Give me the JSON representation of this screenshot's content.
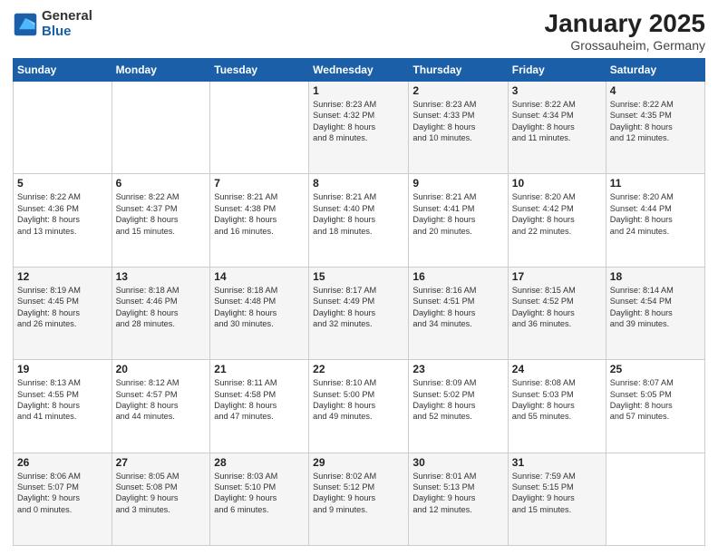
{
  "header": {
    "logo_general": "General",
    "logo_blue": "Blue",
    "title": "January 2025",
    "location": "Grossauheim, Germany"
  },
  "weekdays": [
    "Sunday",
    "Monday",
    "Tuesday",
    "Wednesday",
    "Thursday",
    "Friday",
    "Saturday"
  ],
  "weeks": [
    [
      {
        "day": "",
        "info": ""
      },
      {
        "day": "",
        "info": ""
      },
      {
        "day": "",
        "info": ""
      },
      {
        "day": "1",
        "info": "Sunrise: 8:23 AM\nSunset: 4:32 PM\nDaylight: 8 hours\nand 8 minutes."
      },
      {
        "day": "2",
        "info": "Sunrise: 8:23 AM\nSunset: 4:33 PM\nDaylight: 8 hours\nand 10 minutes."
      },
      {
        "day": "3",
        "info": "Sunrise: 8:22 AM\nSunset: 4:34 PM\nDaylight: 8 hours\nand 11 minutes."
      },
      {
        "day": "4",
        "info": "Sunrise: 8:22 AM\nSunset: 4:35 PM\nDaylight: 8 hours\nand 12 minutes."
      }
    ],
    [
      {
        "day": "5",
        "info": "Sunrise: 8:22 AM\nSunset: 4:36 PM\nDaylight: 8 hours\nand 13 minutes."
      },
      {
        "day": "6",
        "info": "Sunrise: 8:22 AM\nSunset: 4:37 PM\nDaylight: 8 hours\nand 15 minutes."
      },
      {
        "day": "7",
        "info": "Sunrise: 8:21 AM\nSunset: 4:38 PM\nDaylight: 8 hours\nand 16 minutes."
      },
      {
        "day": "8",
        "info": "Sunrise: 8:21 AM\nSunset: 4:40 PM\nDaylight: 8 hours\nand 18 minutes."
      },
      {
        "day": "9",
        "info": "Sunrise: 8:21 AM\nSunset: 4:41 PM\nDaylight: 8 hours\nand 20 minutes."
      },
      {
        "day": "10",
        "info": "Sunrise: 8:20 AM\nSunset: 4:42 PM\nDaylight: 8 hours\nand 22 minutes."
      },
      {
        "day": "11",
        "info": "Sunrise: 8:20 AM\nSunset: 4:44 PM\nDaylight: 8 hours\nand 24 minutes."
      }
    ],
    [
      {
        "day": "12",
        "info": "Sunrise: 8:19 AM\nSunset: 4:45 PM\nDaylight: 8 hours\nand 26 minutes."
      },
      {
        "day": "13",
        "info": "Sunrise: 8:18 AM\nSunset: 4:46 PM\nDaylight: 8 hours\nand 28 minutes."
      },
      {
        "day": "14",
        "info": "Sunrise: 8:18 AM\nSunset: 4:48 PM\nDaylight: 8 hours\nand 30 minutes."
      },
      {
        "day": "15",
        "info": "Sunrise: 8:17 AM\nSunset: 4:49 PM\nDaylight: 8 hours\nand 32 minutes."
      },
      {
        "day": "16",
        "info": "Sunrise: 8:16 AM\nSunset: 4:51 PM\nDaylight: 8 hours\nand 34 minutes."
      },
      {
        "day": "17",
        "info": "Sunrise: 8:15 AM\nSunset: 4:52 PM\nDaylight: 8 hours\nand 36 minutes."
      },
      {
        "day": "18",
        "info": "Sunrise: 8:14 AM\nSunset: 4:54 PM\nDaylight: 8 hours\nand 39 minutes."
      }
    ],
    [
      {
        "day": "19",
        "info": "Sunrise: 8:13 AM\nSunset: 4:55 PM\nDaylight: 8 hours\nand 41 minutes."
      },
      {
        "day": "20",
        "info": "Sunrise: 8:12 AM\nSunset: 4:57 PM\nDaylight: 8 hours\nand 44 minutes."
      },
      {
        "day": "21",
        "info": "Sunrise: 8:11 AM\nSunset: 4:58 PM\nDaylight: 8 hours\nand 47 minutes."
      },
      {
        "day": "22",
        "info": "Sunrise: 8:10 AM\nSunset: 5:00 PM\nDaylight: 8 hours\nand 49 minutes."
      },
      {
        "day": "23",
        "info": "Sunrise: 8:09 AM\nSunset: 5:02 PM\nDaylight: 8 hours\nand 52 minutes."
      },
      {
        "day": "24",
        "info": "Sunrise: 8:08 AM\nSunset: 5:03 PM\nDaylight: 8 hours\nand 55 minutes."
      },
      {
        "day": "25",
        "info": "Sunrise: 8:07 AM\nSunset: 5:05 PM\nDaylight: 8 hours\nand 57 minutes."
      }
    ],
    [
      {
        "day": "26",
        "info": "Sunrise: 8:06 AM\nSunset: 5:07 PM\nDaylight: 9 hours\nand 0 minutes."
      },
      {
        "day": "27",
        "info": "Sunrise: 8:05 AM\nSunset: 5:08 PM\nDaylight: 9 hours\nand 3 minutes."
      },
      {
        "day": "28",
        "info": "Sunrise: 8:03 AM\nSunset: 5:10 PM\nDaylight: 9 hours\nand 6 minutes."
      },
      {
        "day": "29",
        "info": "Sunrise: 8:02 AM\nSunset: 5:12 PM\nDaylight: 9 hours\nand 9 minutes."
      },
      {
        "day": "30",
        "info": "Sunrise: 8:01 AM\nSunset: 5:13 PM\nDaylight: 9 hours\nand 12 minutes."
      },
      {
        "day": "31",
        "info": "Sunrise: 7:59 AM\nSunset: 5:15 PM\nDaylight: 9 hours\nand 15 minutes."
      },
      {
        "day": "",
        "info": ""
      }
    ]
  ]
}
